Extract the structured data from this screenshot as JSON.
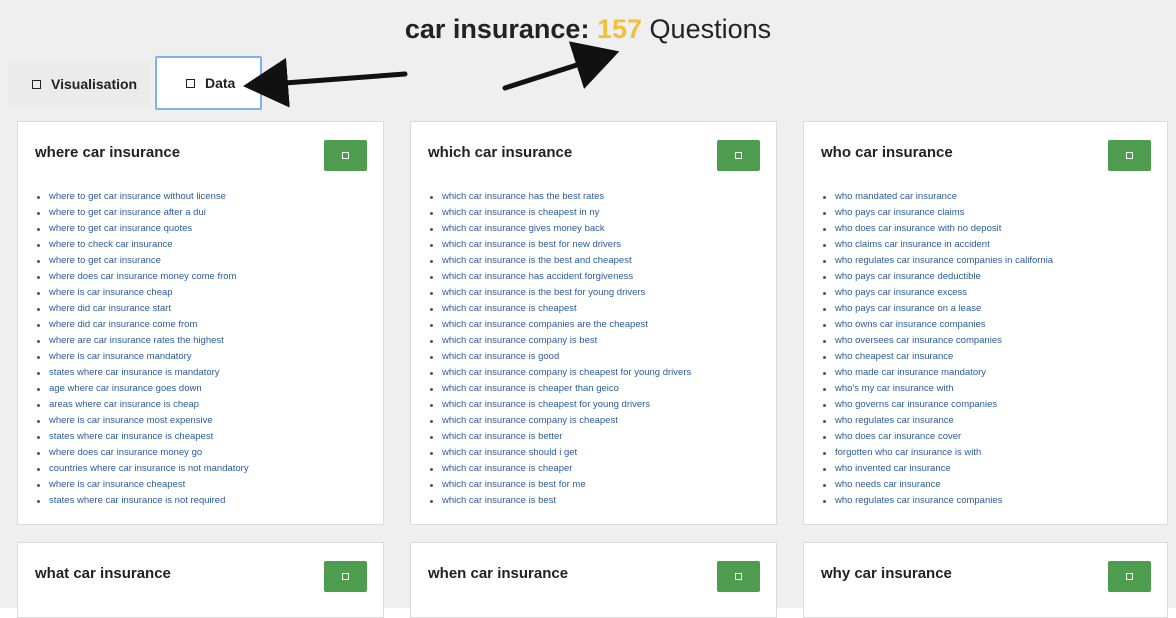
{
  "header": {
    "keyword": "car insurance:",
    "count": "157",
    "suffix": "Questions"
  },
  "tabs": [
    {
      "label": "Visualisation"
    },
    {
      "label": "Data"
    }
  ],
  "cards": [
    {
      "title": "where car insurance",
      "items": [
        "where to get car insurance without license",
        "where to get car insurance after a dui",
        "where to get car insurance quotes",
        "where to check car insurance",
        "where to get car insurance",
        "where does car insurance money come from",
        "where is car insurance cheap",
        "where did car insurance start",
        "where did car insurance come from",
        "where are car insurance rates the highest",
        "where is car insurance mandatory",
        "states where car insurance is mandatory",
        "age where car insurance goes down",
        "areas where car insurance is cheap",
        "where is car insurance most expensive",
        "states where car insurance is cheapest",
        "where does car insurance money go",
        "countries where car insurance is not mandatory",
        "where is car insurance cheapest",
        "states where car insurance is not required"
      ]
    },
    {
      "title": "which car insurance",
      "items": [
        "which car insurance has the best rates",
        "which car insurance is cheapest in ny",
        "which car insurance gives money back",
        "which car insurance is best for new drivers",
        "which car insurance is the best and cheapest",
        "which car insurance has accident forgiveness",
        "which car insurance is the best for young drivers",
        "which car insurance is cheapest",
        "which car insurance companies are the cheapest",
        "which car insurance company is best",
        "which car insurance is good",
        "which car insurance company is cheapest for young drivers",
        "which car insurance is cheaper than geico",
        "which car insurance is cheapest for young drivers",
        "which car insurance company is cheapest",
        "which car insurance is better",
        "which car insurance should i get",
        "which car insurance is cheaper",
        "which car insurance is best for me",
        "which car insurance is best"
      ]
    },
    {
      "title": "who car insurance",
      "items": [
        "who mandated car insurance",
        "who pays car insurance claims",
        "who does car insurance with no deposit",
        "who claims car insurance in accident",
        "who regulates car insurance companies in california",
        "who pays car insurance deductible",
        "who pays car insurance excess",
        "who pays car insurance on a lease",
        "who owns car insurance companies",
        "who oversees car insurance companies",
        "who cheapest car insurance",
        "who made car insurance mandatory",
        "who's my car insurance with",
        "who governs car insurance companies",
        "who regulates car insurance",
        "who does car insurance cover",
        "forgotten who car insurance is with",
        "who invented car insurance",
        "who needs car insurance",
        "who regulates car insurance companies"
      ]
    },
    {
      "title": "what car insurance",
      "items": []
    },
    {
      "title": "when car insurance",
      "items": []
    },
    {
      "title": "why car insurance",
      "items": []
    }
  ],
  "colors": {
    "accent_count": "#f0c23b",
    "button_green": "#4e9c4e",
    "link_blue": "#2a5c9a",
    "tab_highlight": "#7fb1ec"
  },
  "icons": {
    "tab_icon": "square-outline-icon",
    "card_button_icon": "square-outline-icon"
  }
}
